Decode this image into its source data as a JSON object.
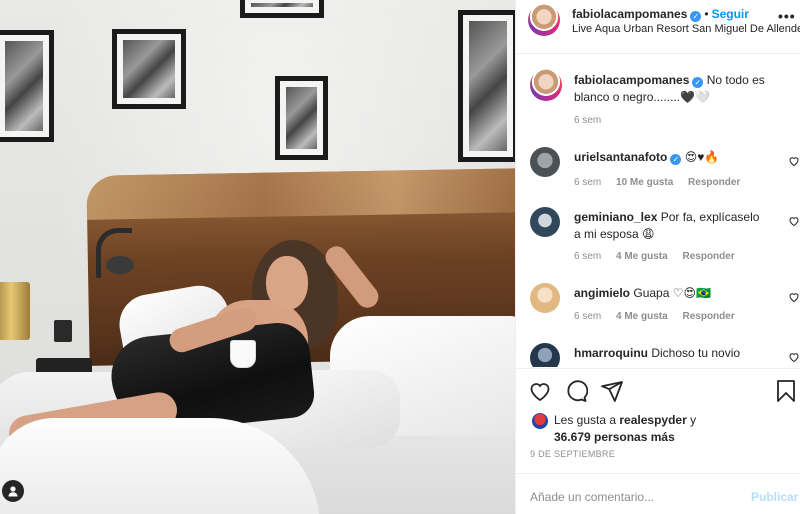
{
  "post": {
    "author": "fabiolacampomanes",
    "follow_separator": "•",
    "follow_label": "Seguir",
    "location": "Live Aqua Urban Resort San Miguel De Allende",
    "more_icon": "more-options-icon",
    "more_label": "•••"
  },
  "caption": {
    "author": "fabiolacampomanes",
    "text": "No todo es blanco o negro........🖤🤍",
    "time": "6 sem"
  },
  "comments": [
    {
      "author": "urielsantanafoto",
      "verified": true,
      "text": "😍♥🔥",
      "time": "6 sem",
      "likes": "10 Me gusta",
      "reply": "Responder"
    },
    {
      "author": "geminiano_lex",
      "verified": false,
      "text": "Por fa, explícaselo a mi esposa 😩",
      "time": "6 sem",
      "likes": "4 Me gusta",
      "reply": "Responder"
    },
    {
      "author": "angimielo",
      "verified": false,
      "text": "Guapa ♡😍🇧🇷",
      "time": "6 sem",
      "likes": "4 Me gusta",
      "reply": "Responder"
    },
    {
      "author": "hmarroquinu",
      "verified": false,
      "text": "Dichoso tu novio",
      "time": "",
      "likes": "",
      "reply": ""
    }
  ],
  "actions": {
    "like_icon": "heart-icon",
    "comment_icon": "comment-icon",
    "share_icon": "share-icon",
    "save_icon": "bookmark-icon"
  },
  "likes": {
    "prefix": "Les gusta a",
    "user": "realespyder",
    "connector": "y",
    "others": "36.679 personas más"
  },
  "date": "9 DE SEPTIEMBRE",
  "add_comment": {
    "placeholder": "Añade un comentario...",
    "publish_label": "Publicar"
  },
  "colors": {
    "link_blue": "#0095f6",
    "verified_blue": "#3897f0",
    "publish_disabled": "#b2dffc",
    "muted_text": "#8e8e8e"
  }
}
